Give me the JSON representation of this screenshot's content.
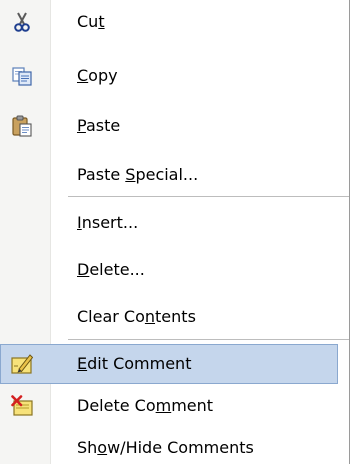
{
  "context_menu": {
    "items": [
      {
        "id": "cut",
        "icon": "scissors-icon",
        "pre": "Cu",
        "key": "t",
        "post": ""
      },
      {
        "id": "copy",
        "icon": "copy-icon",
        "pre": "",
        "key": "C",
        "post": "opy"
      },
      {
        "id": "paste",
        "icon": "paste-icon",
        "pre": "",
        "key": "P",
        "post": "aste"
      },
      {
        "id": "paste-special",
        "icon": "",
        "pre": "Paste ",
        "key": "S",
        "post": "pecial..."
      },
      {
        "id": "insert",
        "icon": "",
        "pre": "",
        "key": "I",
        "post": "nsert..."
      },
      {
        "id": "delete",
        "icon": "",
        "pre": "",
        "key": "D",
        "post": "elete..."
      },
      {
        "id": "clear-contents",
        "icon": "",
        "pre": "Clear Co",
        "key": "n",
        "post": "tents"
      },
      {
        "id": "edit-comment",
        "icon": "edit-comment-icon",
        "pre": "",
        "key": "E",
        "post": "dit Comment",
        "highlighted": true
      },
      {
        "id": "delete-comment",
        "icon": "delete-comment-icon",
        "pre": "Delete Co",
        "key": "m",
        "post": "ment"
      },
      {
        "id": "show-hide-comments",
        "icon": "",
        "pre": "Sh",
        "key": "o",
        "post": "w/Hide Comments"
      }
    ]
  },
  "colors": {
    "highlight_background": "#c5d6ec",
    "highlight_border": "#8aa8cf",
    "gutter": "#f5f5f3",
    "separator": "#bdbdbd"
  }
}
